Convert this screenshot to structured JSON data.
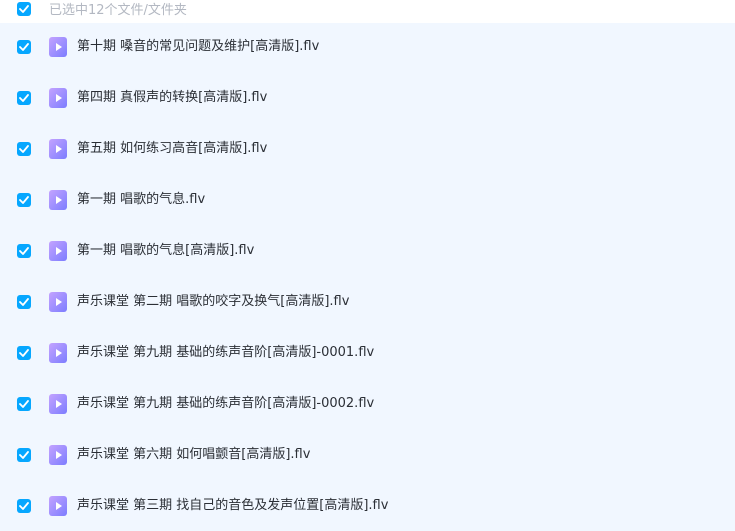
{
  "header": {
    "selected_text": "已选中12个文件/文件夹"
  },
  "colors": {
    "accent": "#06a7ff",
    "row_background": "#f1f7ff",
    "video_icon_start": "#c4a3ff",
    "video_icon_end": "#7c7dff"
  },
  "icons": {
    "checkbox": "checkbox-checked-icon",
    "file": "video-file-icon"
  },
  "files": [
    {
      "name": "第十期 嗓音的常见问题及维护[高清版].flv",
      "checked": true
    },
    {
      "name": "第四期 真假声的转换[高清版].flv",
      "checked": true
    },
    {
      "name": "第五期 如何练习高音[高清版].flv",
      "checked": true
    },
    {
      "name": "第一期 唱歌的气息.flv",
      "checked": true
    },
    {
      "name": "第一期 唱歌的气息[高清版].flv",
      "checked": true
    },
    {
      "name": "声乐课堂 第二期 唱歌的咬字及换气[高清版].flv",
      "checked": true
    },
    {
      "name": "声乐课堂 第九期 基础的练声音阶[高清版]-0001.flv",
      "checked": true
    },
    {
      "name": "声乐课堂 第九期 基础的练声音阶[高清版]-0002.flv",
      "checked": true
    },
    {
      "name": "声乐课堂 第六期 如何唱颤音[高清版].flv",
      "checked": true
    },
    {
      "name": "声乐课堂 第三期 找自己的音色及发声位置[高清版].flv",
      "checked": true
    }
  ]
}
